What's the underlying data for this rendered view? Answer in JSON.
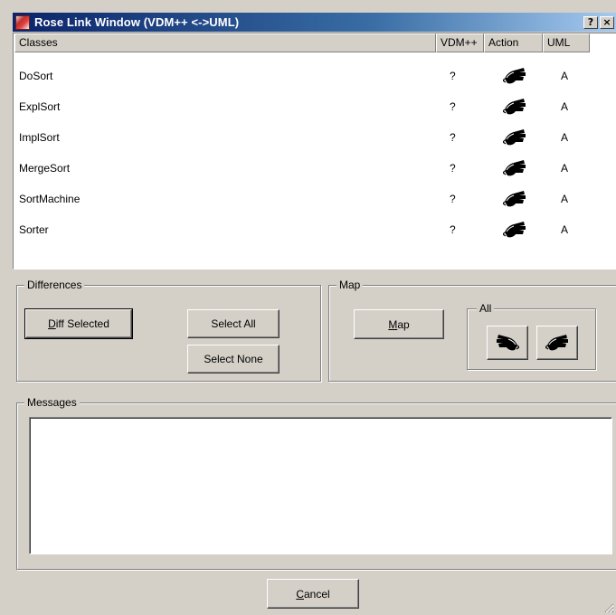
{
  "window": {
    "title": "Rose Link Window (VDM++ <->UML)",
    "help_label": "?",
    "close_label": "×"
  },
  "table": {
    "headers": [
      "Classes",
      "VDM++",
      "Action",
      "UML"
    ],
    "rows": [
      {
        "name": "DoSort",
        "vdm": "?",
        "action_icon": "hand-pointing-left-icon",
        "uml": "A"
      },
      {
        "name": "ExplSort",
        "vdm": "?",
        "action_icon": "hand-pointing-left-icon",
        "uml": "A"
      },
      {
        "name": "ImplSort",
        "vdm": "?",
        "action_icon": "hand-pointing-left-icon",
        "uml": "A"
      },
      {
        "name": "MergeSort",
        "vdm": "?",
        "action_icon": "hand-pointing-left-icon",
        "uml": "A"
      },
      {
        "name": "SortMachine",
        "vdm": "?",
        "action_icon": "hand-pointing-left-icon",
        "uml": "A"
      },
      {
        "name": "Sorter",
        "vdm": "?",
        "action_icon": "hand-pointing-left-icon",
        "uml": "A"
      }
    ]
  },
  "differences": {
    "label": "Differences",
    "diff_selected_prefix": "D",
    "diff_selected_rest": "iff Selected",
    "select_all": "Select All",
    "select_none": "Select None"
  },
  "map": {
    "label": "Map",
    "map_button_prefix": "M",
    "map_button_rest": "ap",
    "all_label": "All",
    "all_right_icon": "hand-pointing-right-icon",
    "all_left_icon": "hand-pointing-left-icon"
  },
  "messages": {
    "label": "Messages",
    "content": ""
  },
  "footer": {
    "cancel_prefix": "C",
    "cancel_rest": "ancel"
  },
  "colors": {
    "face": "#d4d0c8",
    "title_start": "#0a246a",
    "title_end": "#a6caf0"
  }
}
